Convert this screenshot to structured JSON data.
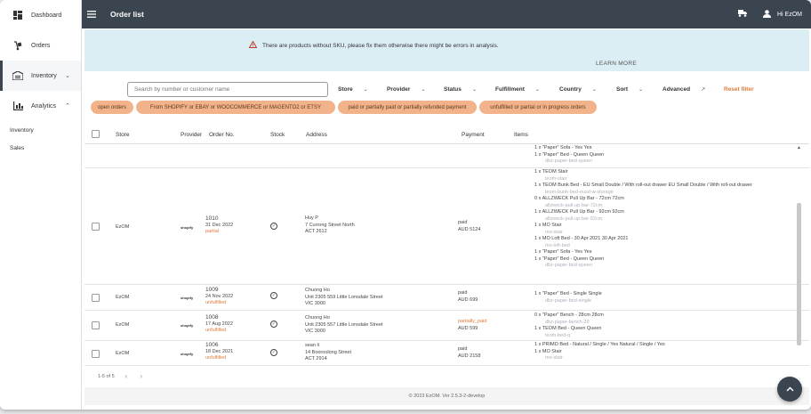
{
  "sidebar": {
    "items": [
      {
        "label": "Dashboard",
        "icon": "dashboard-icon"
      },
      {
        "label": "Orders",
        "icon": "dolly-icon"
      },
      {
        "label": "Inventory",
        "icon": "warehouse-icon"
      },
      {
        "label": "Analytics",
        "icon": "analytics-icon"
      }
    ],
    "sub_items": [
      "Inventory",
      "Sales"
    ]
  },
  "topbar": {
    "title": "Order list",
    "greeting": "Hi EzOM"
  },
  "alert": {
    "message": "There are products without SKU, please fix them otherwise there might be errors in analysis.",
    "learn_more": "LEARN MORE"
  },
  "filters": {
    "search_placeholder": "Search by number or customer name",
    "labels": [
      "Store",
      "Provider",
      "Status",
      "Fulfillment",
      "Country",
      "Sort",
      "Advanced"
    ],
    "reset": "Reset filter",
    "chips": [
      "open orders",
      "From SHOPIFY or EBAY or WOOCOMMERCE or MAGENTO2 or ETSY",
      "paid or partially paid or partially refunded payment",
      "unfulfilled or partial or in progress orders"
    ]
  },
  "table": {
    "headers": [
      "Store",
      "Provider",
      "Order No.",
      "Stock",
      "Address",
      "Payment",
      "Items"
    ],
    "partial_items": [
      [
        "1 x",
        "\"Paper\" Sofa - Yes Yes"
      ],
      [
        "1 x",
        "\"Paper\" Bed - Queen Queen"
      ],
      [
        "",
        "dbz-paper-bed-queen"
      ]
    ],
    "rows": [
      {
        "store": "EzOM",
        "provider": "shopify",
        "order_no": "1010",
        "date": "31 Dec 2022",
        "status": "partial",
        "name": "Huy P",
        "street": "7 Currong Street North",
        "region": "ACT 2612",
        "pay_status": "paid",
        "amount": "AUD 5124",
        "items": [
          [
            "1 x",
            "TEOM Stair"
          ],
          [
            "",
            "teom-stair"
          ],
          [
            "1 x",
            "TEOM Bunk Bed - EU Small Double / With roll-out drawer EU Small Double / With roll-out drawer"
          ],
          [
            "",
            "teom-bunk-bed-eusd-w-storage"
          ],
          [
            "0 x",
            "ALLZWECK Pull Up Bar - 72cm 72cm"
          ],
          [
            "",
            "allzweck-pull-up-bar-72cm"
          ],
          [
            "1 x",
            "ALLZWECK Pull Up Bar - 92cm 92cm"
          ],
          [
            "",
            "allzweck-pull-up-bar-92cm"
          ],
          [
            "1 x",
            "MO Stair"
          ],
          [
            "",
            "mo-stair"
          ],
          [
            "1 x",
            "MO Loft Bed - 30 Apr 2021 30 Apr 2021"
          ],
          [
            "",
            "mo-loft-bed"
          ],
          [
            "1 x",
            "\"Paper\" Sofa - Yes Yes"
          ],
          [
            "1 x",
            "\"Paper\" Bed - Queen Queen"
          ],
          [
            "",
            "dbz-paper-bed-queen"
          ]
        ]
      },
      {
        "store": "EzOM",
        "provider": "shopify",
        "order_no": "1009",
        "date": "24 Nov 2022",
        "status": "unfulfilled",
        "name": "Chuong Ho",
        "street": "Unit 2305 559 Little Lonsdale Street",
        "region": "VIC 3000",
        "pay_status": "paid",
        "amount": "AUD 699",
        "items": [
          [
            "1 x",
            "\"Paper\" Bed - Single Single"
          ],
          [
            "",
            "dbz-paper-bed-single"
          ]
        ]
      },
      {
        "store": "EzOM",
        "provider": "shopify",
        "order_no": "1008",
        "date": "17 Aug 2022",
        "status": "unfulfilled",
        "name": "Chuong Ho",
        "street": "Unit 2305 557 Little Lonsdale Street",
        "region": "VIC 3000",
        "pay_status": "partially_paid",
        "amount": "AUD 599",
        "items": [
          [
            "0 x",
            "\"Paper\" Bench - 28cm 28cm"
          ],
          [
            "",
            "dbz-paper-bench-28"
          ],
          [
            "1 x",
            "TEOM Bed - Queen Queen"
          ],
          [
            "",
            "teom-bed-q"
          ]
        ]
      },
      {
        "store": "EzOM",
        "provider": "shopify",
        "order_no": "1006",
        "date": "18 Dec 2021",
        "status": "unfulfilled",
        "name": "sean li",
        "street": "14 Booroolong Street",
        "region": "ACT 2914",
        "pay_status": "paid",
        "amount": "AUD 2158",
        "items": [
          [
            "1 x",
            "PRIMO Bed - Natural / Single / Yes Natural / Single / Yes"
          ],
          [
            "1 x",
            "MO Stair"
          ],
          [
            "",
            "mo-stair"
          ]
        ]
      }
    ]
  },
  "pager": {
    "range": "1-5 of 5"
  },
  "footer": "© 2023 EzOM. Ver 2.5.3-2-develop"
}
